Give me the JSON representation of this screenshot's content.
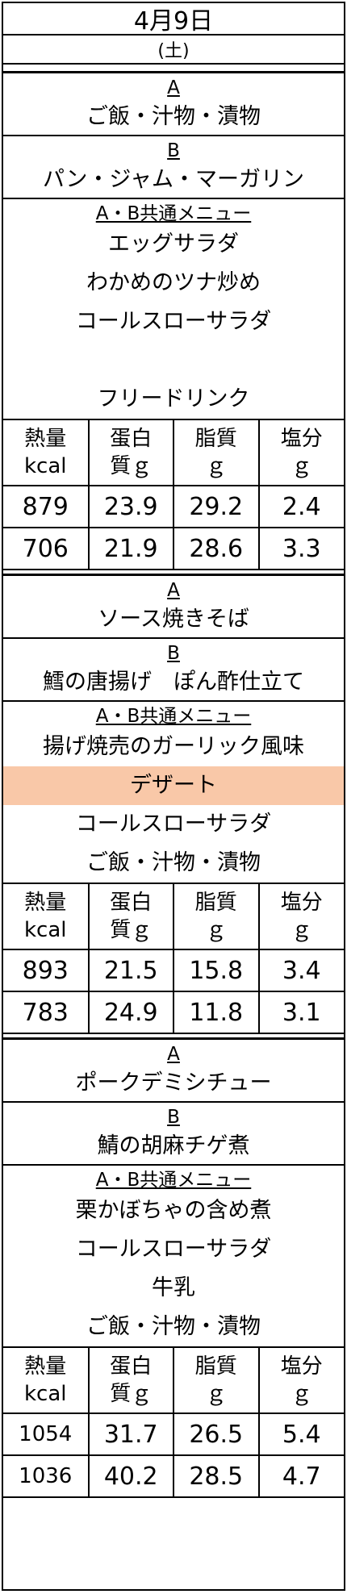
{
  "header": {
    "date": "4月9日",
    "weekday": "(土)"
  },
  "nutrition_headers": [
    [
      "熱量",
      "kcal"
    ],
    [
      "蛋白",
      "質ｇ"
    ],
    [
      "脂質",
      "ｇ"
    ],
    [
      "塩分",
      "ｇ"
    ]
  ],
  "meals": [
    {
      "a_label": "A",
      "a_dish": "ご飯・汁物・漬物",
      "b_label": "B",
      "b_dish": "パン・ジャム・マーガリン",
      "common_label": "A・B共通メニュー",
      "common_items": [
        "エッグサラダ",
        "わかめのツナ炒め",
        "コールスローサラダ",
        "",
        "フリードリンク"
      ],
      "nutrition_rows": [
        [
          "879",
          "23.9",
          "29.2",
          "2.4"
        ],
        [
          "706",
          "21.9",
          "28.6",
          "3.3"
        ]
      ]
    },
    {
      "a_label": "A",
      "a_dish": "ソース焼きそば",
      "b_label": "B",
      "b_dish": "鱈の唐揚げ　ぽん酢仕立て",
      "common_label": "A・B共通メニュー",
      "common_items": [
        "揚げ焼売のガーリック風味",
        "デザート",
        "コールスローサラダ",
        "ご飯・汁物・漬物"
      ],
      "highlight_index": 1,
      "highlight_color": "#f9c8a8",
      "nutrition_rows": [
        [
          "893",
          "21.5",
          "15.8",
          "3.4"
        ],
        [
          "783",
          "24.9",
          "11.8",
          "3.1"
        ]
      ]
    },
    {
      "a_label": "A",
      "a_dish": "ポークデミシチュー",
      "b_label": "B",
      "b_dish": "鯖の胡麻チゲ煮",
      "common_label": "A・B共通メニュー",
      "common_items": [
        "栗かぼちゃの含め煮",
        "コールスローサラダ",
        "牛乳",
        "ご飯・汁物・漬物"
      ],
      "nutrition_rows": [
        [
          "1054",
          "31.7",
          "26.5",
          "5.4"
        ],
        [
          "1036",
          "40.2",
          "28.5",
          "4.7"
        ]
      ]
    }
  ]
}
